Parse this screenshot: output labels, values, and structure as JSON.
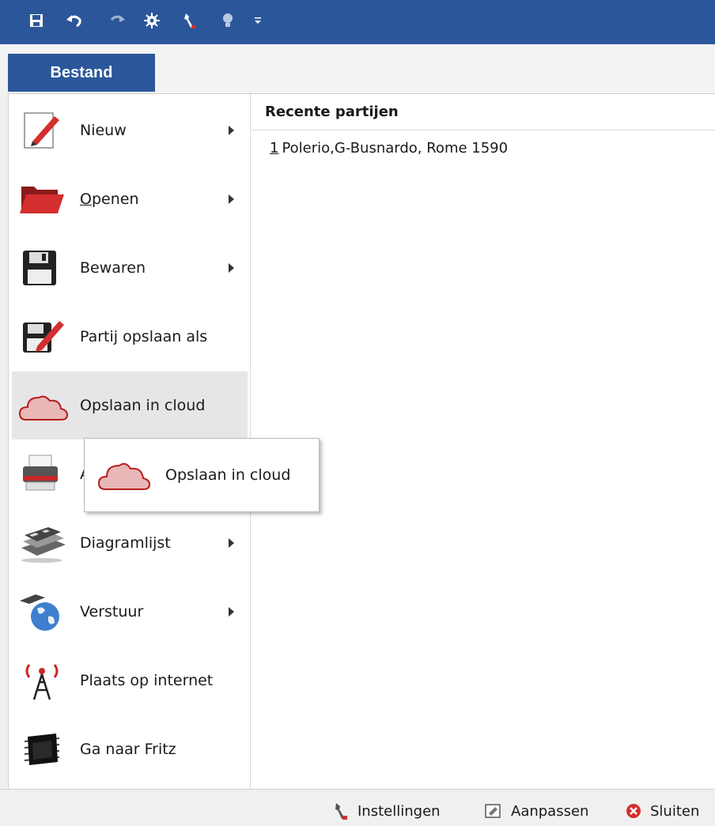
{
  "quick_access": {
    "icons": [
      "save-icon",
      "undo-icon",
      "redo-icon",
      "engine-icon",
      "wrench-icon",
      "lightbulb-icon",
      "customize-dropdown-icon"
    ]
  },
  "tabs": {
    "file_label": "Bestand"
  },
  "menu": {
    "items": [
      {
        "label": "Nieuw",
        "has_submenu": true
      },
      {
        "label_prefix": "",
        "label_underlined": "O",
        "label_rest": "penen",
        "has_submenu": true
      },
      {
        "label": "Bewaren",
        "has_submenu": true
      },
      {
        "label": "Partij opslaan als",
        "has_submenu": false
      },
      {
        "label": "Opslaan in cloud",
        "has_submenu": false,
        "hovered": true
      },
      {
        "label": "A",
        "has_submenu": false
      },
      {
        "label": "Diagramlijst",
        "has_submenu": true
      },
      {
        "label": "Verstuur",
        "has_submenu": true
      },
      {
        "label": "Plaats op internet",
        "has_submenu": false
      },
      {
        "label": "Ga naar Fritz",
        "has_submenu": false
      }
    ]
  },
  "recent": {
    "header": "Recente partijen",
    "items": [
      {
        "number": "1",
        "text": "Polerio,G-Busnardo, Rome 1590"
      }
    ]
  },
  "tooltip": {
    "label": "Opslaan in cloud"
  },
  "statusbar": {
    "settings_label": "Instellingen",
    "customize_label": "Aanpassen",
    "close_label": "Sluiten"
  },
  "colors": {
    "accent": "#2b579a",
    "cloud": "#c0393b",
    "hover": "#e6e6e6"
  }
}
